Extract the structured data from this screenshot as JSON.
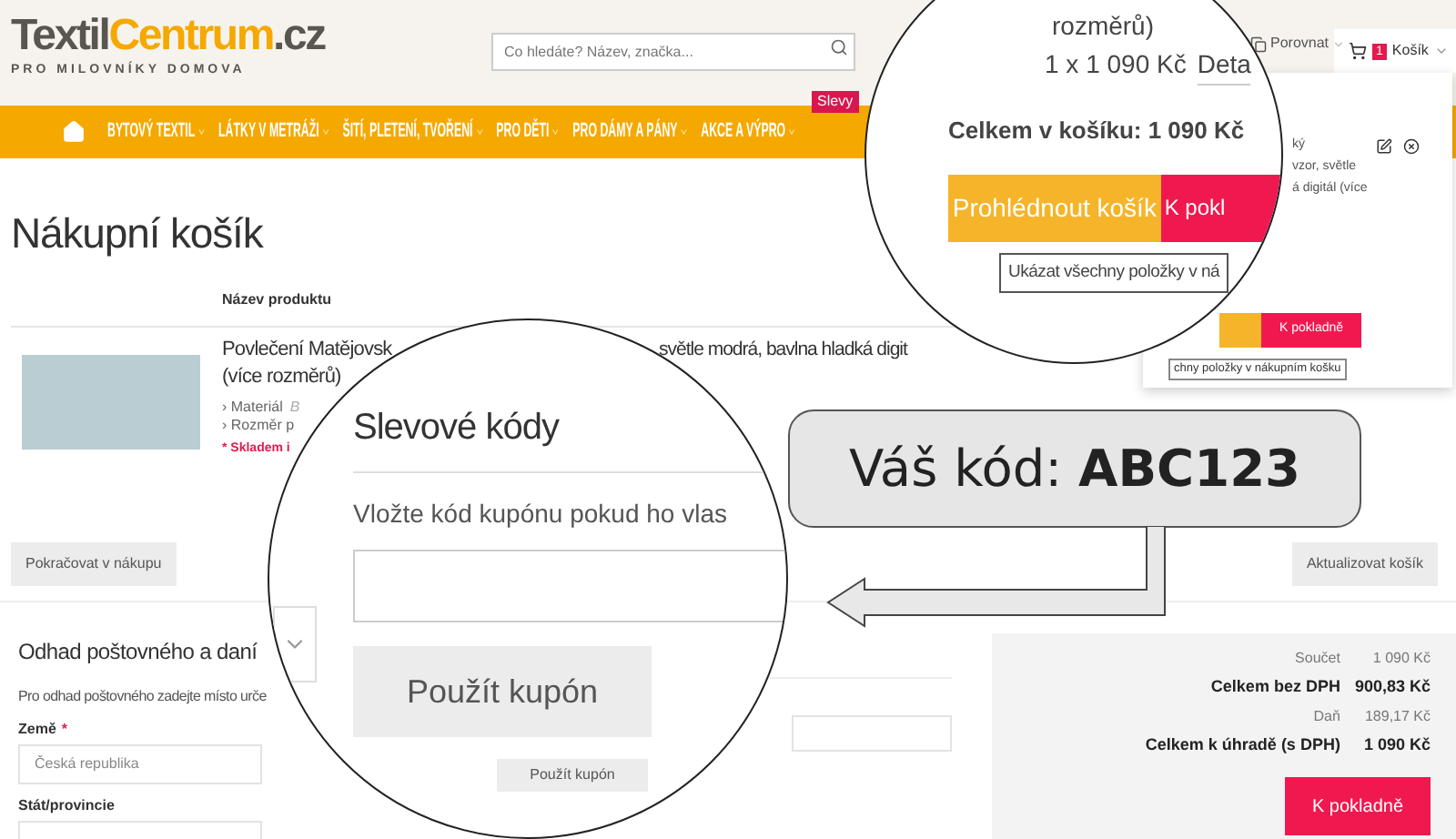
{
  "header": {
    "logo": {
      "part_1": "Textil",
      "part_2": "Centrum",
      "part_3": ".cz",
      "tagline": "PRO MILOVNÍKY DOMOVA"
    },
    "search": {
      "placeholder": "Co hledáte? Název, značka..."
    },
    "compare": "Porovnat",
    "cart": {
      "count": "1",
      "label": "Košík"
    }
  },
  "nav": {
    "items": [
      "BYTOVÝ TEXTIL",
      "LÁTKY V METRÁŽI",
      "ŠITÍ, PLETENÍ, TVOŘENÍ",
      "PRO DĚTI",
      "PRO DÁMY A PÁNY",
      "AKCE A VÝPRO"
    ],
    "badge": "Slevy"
  },
  "mini_cart": {
    "lines": [
      "ký",
      "vzor, světle",
      "á digitál (více"
    ],
    "checkout": "K pokladně",
    "tooltip": "chny položky v nákupním košku"
  },
  "page_title": "Nákupní košík",
  "table": {
    "columns": [
      "Název produktu"
    ],
    "product": {
      "title_start": "Povlečení Matějovsk",
      "title_end": "světle modrá, bavlna hladká digit",
      "title_line_2": "(více rozměrů)",
      "options": [
        {
          "label": "› Materiál",
          "value": "B"
        },
        {
          "label": "› Rozměr p"
        }
      ],
      "stock": "* Skladem i"
    }
  },
  "actions": {
    "continue": "Pokračovat v nákupu",
    "update": "Aktualizovat košík"
  },
  "shipping": {
    "title": "Odhad poštovného a daní",
    "hint": "Pro odhad poštovného zadejte místo urče",
    "country_label": "Země",
    "required": "*",
    "country_value": "Česká republika",
    "state_label": "Stát/provincie"
  },
  "coupon_apply": "Použít kupón",
  "summary": {
    "rows": [
      {
        "label": "Součet",
        "value": "1 090 Kč",
        "bold": false
      },
      {
        "label": "Celkem bez DPH",
        "value": "900,83 Kč",
        "bold": true
      },
      {
        "label": "Daň",
        "value": "189,17 Kč",
        "bold": false
      },
      {
        "label": "Celkem k úhradě (s DPH)",
        "value": "1 090 Kč",
        "bold": true
      }
    ],
    "checkout": "K pokladně"
  },
  "magnifier_cart": {
    "line": "rozměrů)",
    "qty": "1 x 1 090 Kč",
    "detail": "Deta",
    "total": "Celkem v košíku: 1 090 Kč",
    "view_cart": "Prohlédnout košík",
    "checkout": "K pokl",
    "tooltip": "Ukázat všechny položky v ná"
  },
  "magnifier_coupon": {
    "title": "Slevové kódy",
    "hint": "Vložte kód kupónu pokud ho vlas",
    "apply": "Použít kupón"
  },
  "callout": {
    "text": "Váš kód: **ABC123**"
  }
}
